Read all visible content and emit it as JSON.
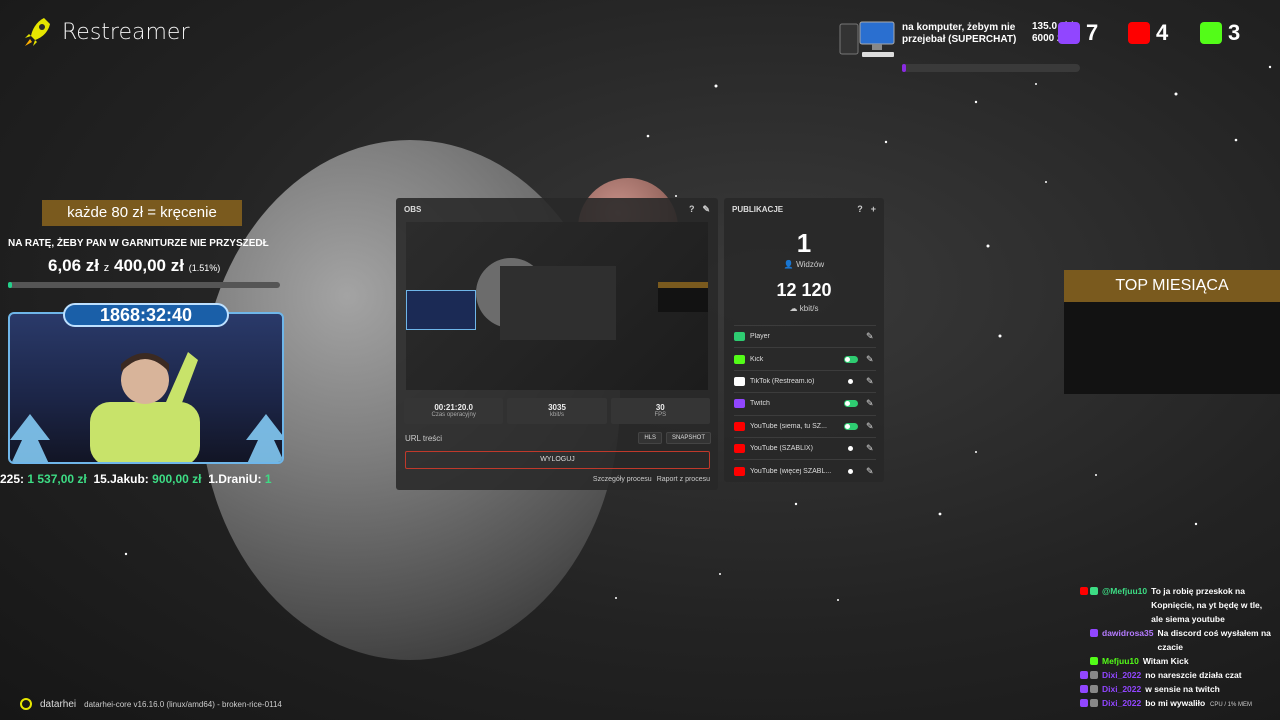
{
  "app": {
    "name": "Restreamer"
  },
  "ticker": {
    "message_line1": "na komputer, żebym nie",
    "message_line2": "przejebał (SUPERCHAT)",
    "amount_line1": "135.0 zł /",
    "amount_line2": "6000 zł",
    "progress": 0.023,
    "twitch_count": "7",
    "youtube_count": "4",
    "kick_count": "3"
  },
  "goal": {
    "title": "każde 80 zł = kręcenie",
    "description": "NA RATĘ, ŻEBY PAN W GARNITURZE NIE PRZYSZEDŁ",
    "current": "6,06 zł",
    "separator": "z",
    "target": "400,00 zł",
    "percent_text": "(1.51%)",
    "progress": 0.0151
  },
  "cam": {
    "timer": "1868:32:40"
  },
  "donors": {
    "items": [
      {
        "name": "225:",
        "amount": "1 537,00 zł"
      },
      {
        "name": "15.Jakub:",
        "amount": "900,00 zł"
      },
      {
        "name": "1.DraniU:",
        "amount": "1"
      }
    ]
  },
  "obs": {
    "title": "OBS",
    "stats": [
      {
        "value": "00:21:20.0",
        "label": "Czas operacyjny"
      },
      {
        "value": "3035",
        "label": "kbit/s"
      },
      {
        "value": "30",
        "label": "FPS"
      }
    ],
    "url_label": "URL treści",
    "hls_label": "HLS",
    "snapshot_label": "SNAPSHOT",
    "logout_label": "WYLOGUJ",
    "process_details": "Szczegóły procesu",
    "process_report": "Raport z procesu"
  },
  "publications": {
    "title": "PUBLIKACJE",
    "viewers": "1",
    "viewers_label": "Widzów",
    "bitrate": "12 120",
    "bitrate_label": "kbit/s",
    "items": [
      {
        "name": "Player",
        "color": "#2ecc71",
        "toggle": "none"
      },
      {
        "name": "Kick",
        "color": "#53fc18",
        "toggle": "on"
      },
      {
        "name": "TikTok (Restream.io)",
        "color": "#ffffff",
        "toggle": "off"
      },
      {
        "name": "Twitch",
        "color": "#9146ff",
        "toggle": "on"
      },
      {
        "name": "YouTube (siema, tu SZ...",
        "color": "#ff0000",
        "toggle": "on"
      },
      {
        "name": "YouTube (SZABLIX)",
        "color": "#ff0000",
        "toggle": "off"
      },
      {
        "name": "YouTube (więcej SZABL...",
        "color": "#ff0000",
        "toggle": "off"
      }
    ]
  },
  "top_month": {
    "title": "TOP MIESIĄCA"
  },
  "chat": {
    "messages": [
      {
        "nick": "@Mefjuu10",
        "nick_color": "#3ddc84",
        "badges": [
          "#ff0000",
          "#3ddc84"
        ],
        "text": "To ja robię przeskok na Kopnięcie, na yt będę w tle, ale siema youtube"
      },
      {
        "nick": "dawidrosa35",
        "nick_color": "#b57bff",
        "badges": [
          "#9146ff"
        ],
        "text": "Na discord coś wysłałem na czacie"
      },
      {
        "nick": "Mefjuu10",
        "nick_color": "#53fc18",
        "badges": [
          "#53fc18"
        ],
        "text": "Witam Kick"
      },
      {
        "nick": "Dixi_2022",
        "nick_color": "#9146ff",
        "badges": [
          "#9146ff",
          "#888888"
        ],
        "text": "no nareszcie działa czat"
      },
      {
        "nick": "Dixi_2022",
        "nick_color": "#9146ff",
        "badges": [
          "#9146ff",
          "#888888"
        ],
        "text": "w sensie na twitch"
      },
      {
        "nick": "Dixi_2022",
        "nick_color": "#9146ff",
        "badges": [
          "#9146ff",
          "#888888"
        ],
        "text": "bo mi wywaliło"
      }
    ]
  },
  "footer": {
    "brand": "datarhei",
    "version": "datarhei-core v16.16.0 (linux/amd64) - broken-rice-0114",
    "cpu": "CPU / 1% MEM"
  }
}
